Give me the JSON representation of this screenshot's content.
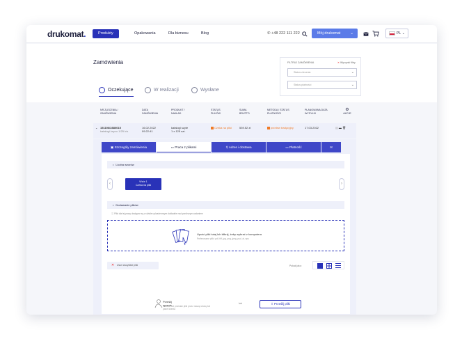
{
  "topbar": {
    "logo": "drukomat",
    "logo_dot": ".",
    "nav": [
      "Produkty",
      "Opakowania",
      "Dla biznesu",
      "Blog"
    ],
    "phone": "+48 222 111 222",
    "account": "Mój drukomat",
    "lang": "PL"
  },
  "header": {
    "title": "Zamówienia",
    "tabs": [
      "Oczekujące",
      "W realizacji",
      "Wysłane"
    ],
    "filter": {
      "label": "FILTRUJ ZAMÓWIENIA",
      "clear": "Wyczyść filtry",
      "select1": "Status zlecenia",
      "select2": "Status płatności"
    }
  },
  "table": {
    "headers": [
      "NR ZLECENIA / ZAMÓWIENIA",
      "DATA ZAMÓWIENIA",
      "PRODUKT / NAKŁAD",
      "STATUS PLIKÓW",
      "SUMA BRUTTO",
      "METODA / STATUS PŁATNOŚCI",
      "PLANOWANA DATA WYSYŁKI",
      "AKCJE"
    ],
    "row": {
      "id": "151196/2880015",
      "sub": "katalogi ksyco 1/25 k/s",
      "date": "16.02.2022",
      "time": "09:22:41",
      "product": "katalogi szyte",
      "qty": "1 x 125 szt.",
      "file_status": "Czeka na pliki",
      "gross": "539.52 zł",
      "payment": "przelew tradycyjny",
      "ship_date": "17.03.2022"
    }
  },
  "panel": {
    "tabs": [
      "Szczegóły zamówienia",
      "Praca z plikami",
      "Adres i dostawa",
      "Płatność"
    ],
    "section_versions": "Liczba wzorów",
    "file_chip_title": "Wzór 1",
    "file_chip_sub": "Czeka na pliki",
    "section_upload": "Dodawanie plików",
    "info": "Pliki dla tej pracy dostępne są w dziale uploaderowym dokładnie nad poniższym zadaniem",
    "drop_title": "Upuść pliki tutaj lub kliknij, żeby wybrać z komputera",
    "drop_sub": "Preferowane pliki: pdf, tiff, jpg, png, jpeg, psd, ai, eps",
    "delete": "Usuń wszystkie pliki",
    "view_label": "Pokaż jako:",
    "manual_title": "Prześlij ręcznie",
    "manual_sub": "Możesz też przesłać pliki przez naszą stronę lub panel klienta",
    "or": "lub",
    "send": "Prześlij pliki"
  },
  "colors": {
    "primary": "#2932b8",
    "accent": "#5b7be8",
    "warning": "#f07a25",
    "panel_bg": "#eef0fa"
  }
}
